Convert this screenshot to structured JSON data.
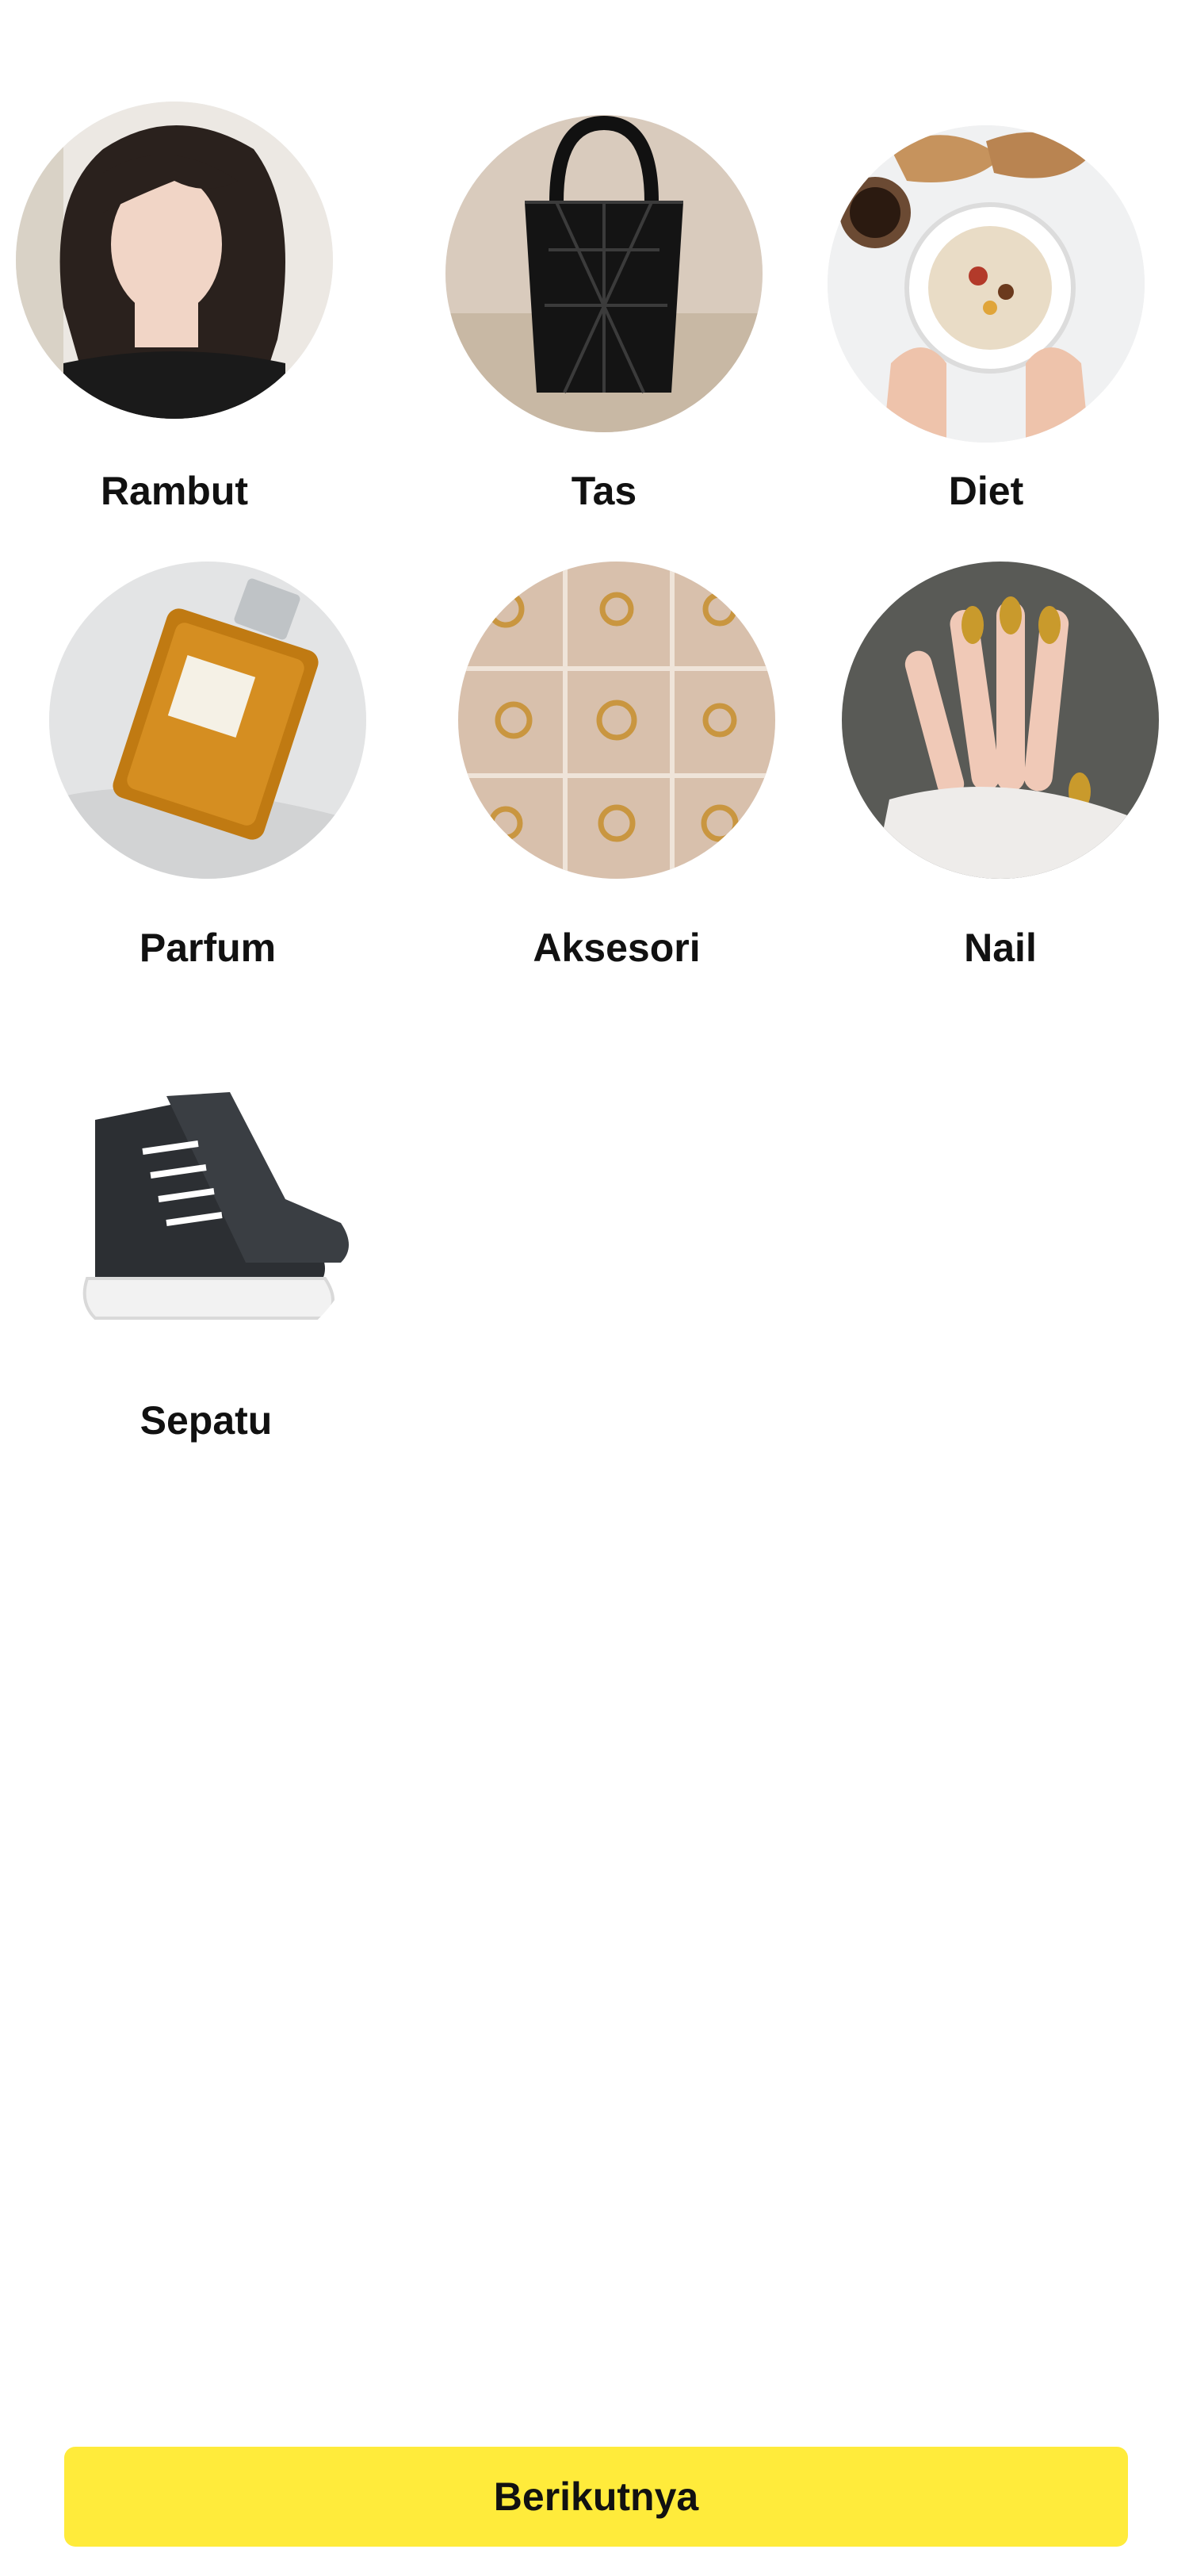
{
  "categories": [
    {
      "label": "Rambut",
      "icon": "hair-photo"
    },
    {
      "label": "Tas",
      "icon": "handbag-photo"
    },
    {
      "label": "Diet",
      "icon": "healthy-bowl-photo"
    },
    {
      "label": "Parfum",
      "icon": "perfume-bottle-photo"
    },
    {
      "label": "Aksesori",
      "icon": "rings-accessories-photo"
    },
    {
      "label": "Nail",
      "icon": "manicure-nails-photo"
    },
    {
      "label": "Sepatu",
      "icon": "sneaker-photo"
    }
  ],
  "next_button": {
    "label": "Berikutnya"
  },
  "colors": {
    "button": "#ffeb3b",
    "text": "#111111",
    "background": "#ffffff"
  }
}
